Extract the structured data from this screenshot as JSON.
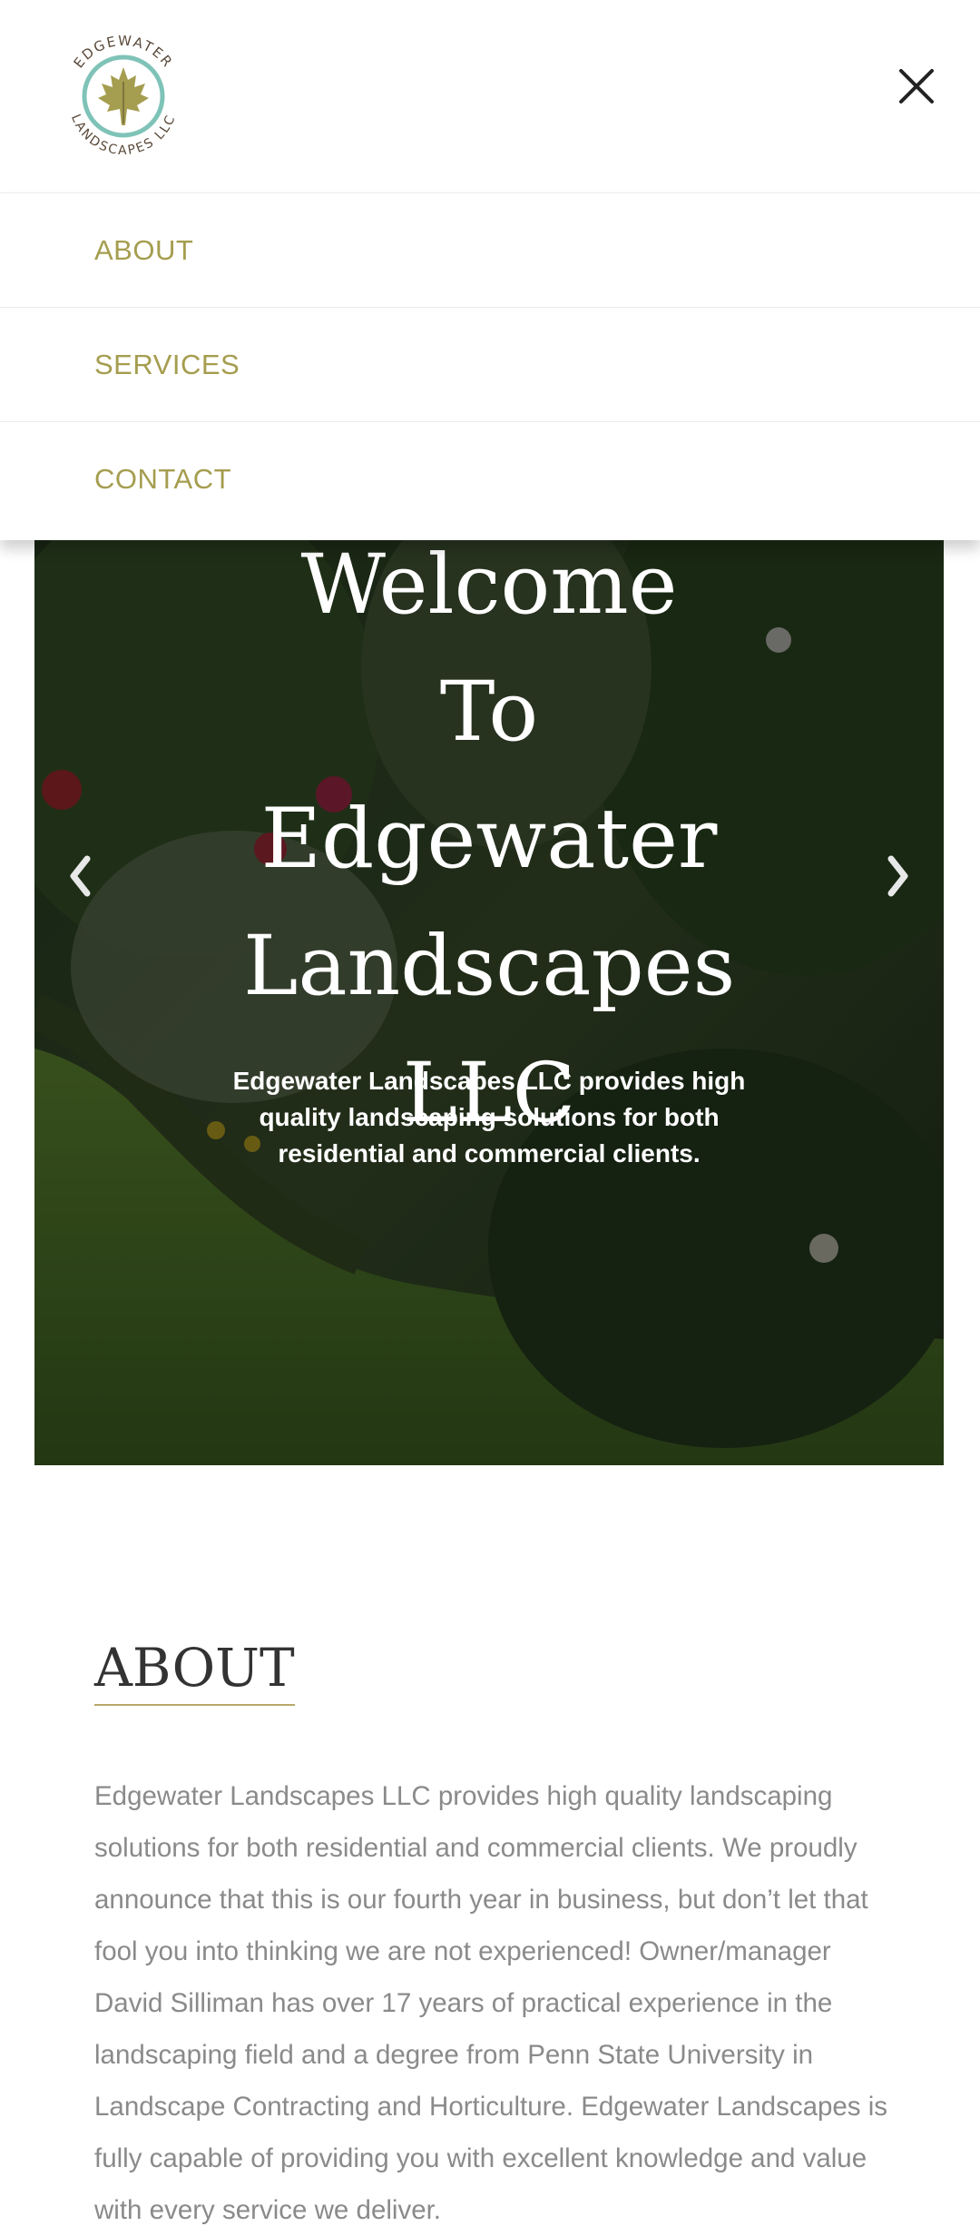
{
  "brand": {
    "logo_top_text": "EDGEWATER",
    "logo_bottom_text": "LANDSCAPES LLC",
    "accent_color": "#a59d4f",
    "logo_ring_color": "#7fc3b8"
  },
  "menu": {
    "items": [
      {
        "label": "ABOUT"
      },
      {
        "label": "SERVICES"
      },
      {
        "label": "CONTACT"
      }
    ]
  },
  "hero": {
    "title": "Welcome To Edgewater Landscapes LLC",
    "text": "Edgewater Landscapes LLC provides high quality landscaping solutions for both residential and commercial clients."
  },
  "about": {
    "heading": "ABOUT",
    "body": "Edgewater Landscapes LLC provides high quality landscaping solutions for both residential and commercial clients.  We proudly announce that this is our fourth year in business, but don’t let that fool you into thinking we are not experienced!  Owner/manager David Silliman has over 17 years of practical experience in the landscaping field and a degree from Penn State University in Landscape Contracting and Horticulture.  Edgewater Landscapes is fully capable of providing you with excellent knowledge and value with every service we deliver."
  },
  "icons": {
    "close": "close-icon",
    "prev": "chevron-left-icon",
    "next": "chevron-right-icon",
    "logo_leaf": "maple-leaf-icon"
  }
}
